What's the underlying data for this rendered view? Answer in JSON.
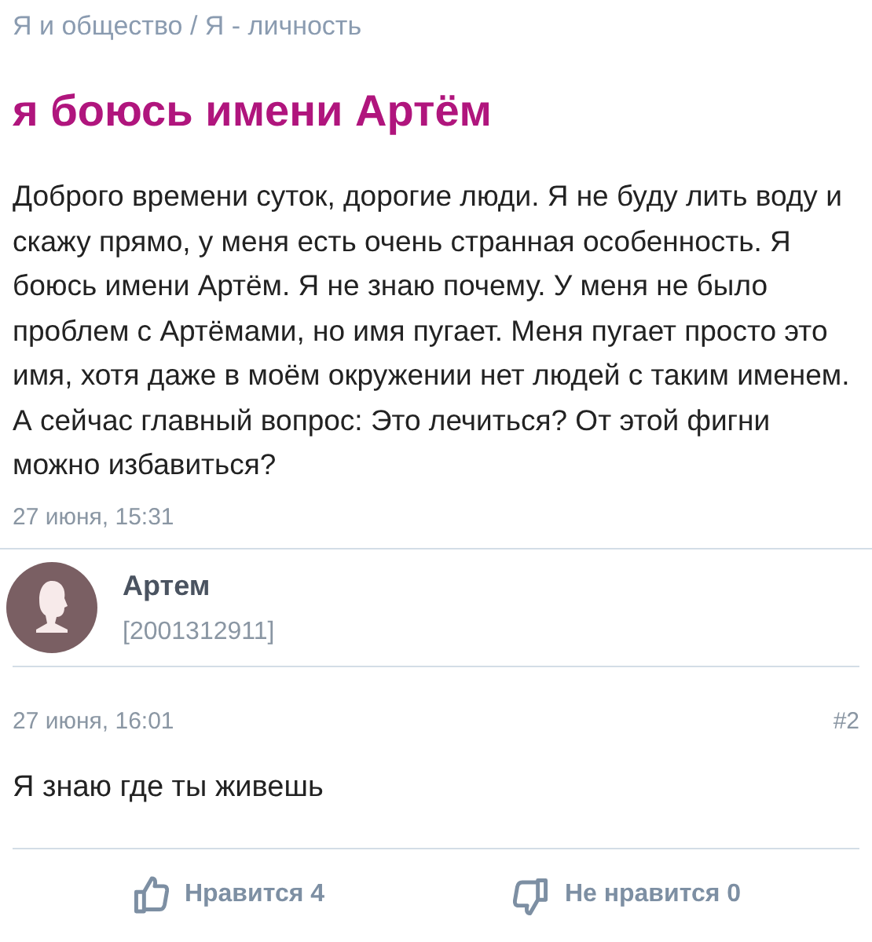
{
  "breadcrumb": "Я и общество / Я - личность",
  "title": "я боюсь имени Артём",
  "question": {
    "text": "Доброго времени суток, дорогие люди. Я не буду лить воду и скажу прямо, у меня есть очень странная особенность. Я боюсь имени Артём. Я не знаю почему. У меня не было проблем с Артёмами, но имя пугает. Меня пугает просто это имя, хотя даже в моём окружении нет людей с таким именем. А сейчас главный вопрос: Это лечиться? От этой фигни можно избавиться?",
    "date": "27 июня, 15:31"
  },
  "author": {
    "name": "Артем",
    "id": "[2001312911]"
  },
  "answer": {
    "date": "27 июня, 16:01",
    "number": "#2",
    "text": "Я знаю где ты живешь"
  },
  "reactions": [
    {
      "kind": "like",
      "label": "Нравится 4"
    },
    {
      "kind": "dislike",
      "label": "Не нравится 0"
    }
  ]
}
